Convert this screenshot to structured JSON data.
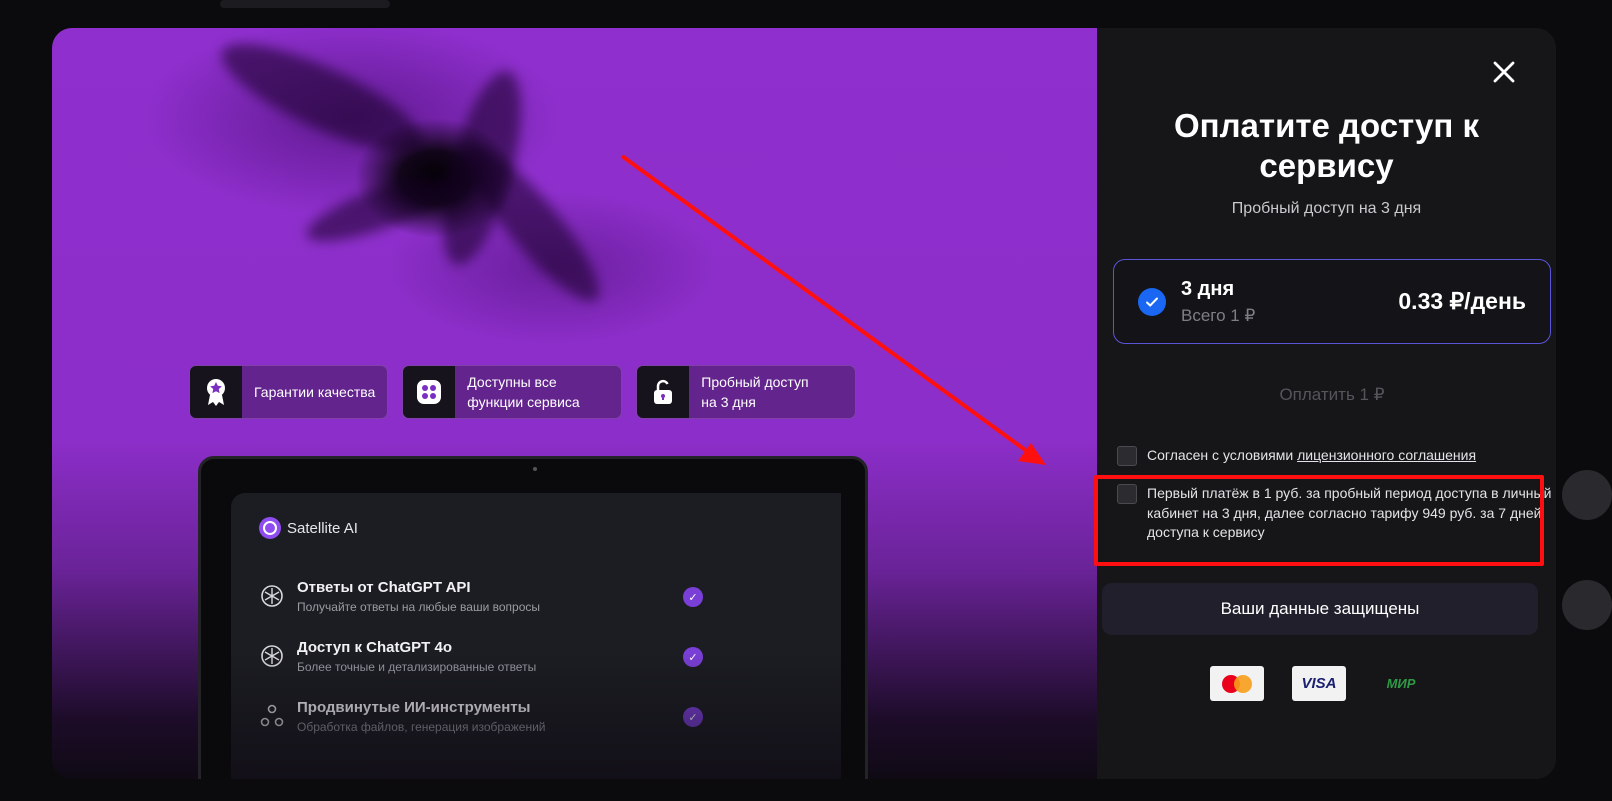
{
  "promo": {
    "features": [
      {
        "icon": "award-badge-icon",
        "label": "Гарантии качества"
      },
      {
        "icon": "grid-functions-icon",
        "label": "Доступны все\nфункции сервиса"
      },
      {
        "icon": "unlock-icon",
        "label": "Пробный доступ\nна 3 дня"
      }
    ],
    "app": {
      "brand": "Satellite AI",
      "services": [
        {
          "title": "Ответы от ChatGPT API",
          "subtitle": "Получайте ответы на любые ваши вопросы"
        },
        {
          "title": "Доступ к ChatGPT 4o",
          "subtitle": "Более точные и детализированные ответы"
        },
        {
          "title": "Продвинутые ИИ-инструменты",
          "subtitle": "Обработка файлов, генерация изображений"
        }
      ]
    }
  },
  "panel": {
    "title": "Оплатите доступ к\nсервису",
    "subtitle": "Пробный доступ на 3 дня",
    "plan": {
      "name": "3 дня",
      "total": "Всего 1 ₽",
      "price": "0.33 ₽/день"
    },
    "pay_label": "Оплатить 1 ₽",
    "agree_license_prefix": "Согласен с условиями ",
    "agree_license_link": "лицензионного соглашения",
    "agree_terms": "Первый платёж в 1 руб. за пробный период доступа в личный кабинет на 3 дня, далее согласно тарифу 949 руб. за 7 дней доступа к сервису",
    "secure_label": "Ваши данные защищены",
    "payment_methods": [
      "Mastercard",
      "VISA",
      "МИР"
    ]
  },
  "colors": {
    "accent_purple": "#8f2fce",
    "radio_blue": "#1967f2",
    "highlight_red": "#ff0f0f",
    "plan_border": "#5a55d8"
  }
}
